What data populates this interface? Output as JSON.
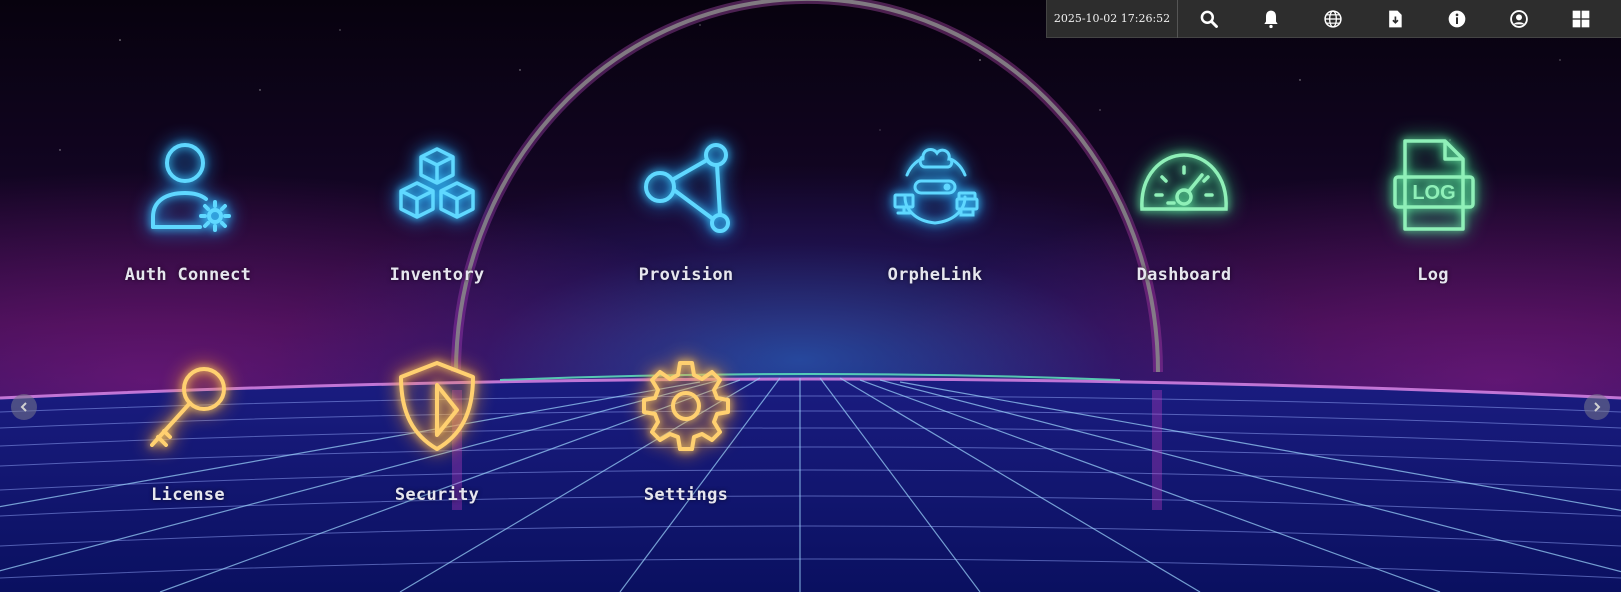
{
  "topbar": {
    "datetime": "2025-10-02 17:26:52",
    "buttons": [
      {
        "name": "search-button",
        "icon": "search-icon"
      },
      {
        "name": "notifications-button",
        "icon": "bell-icon"
      },
      {
        "name": "language-button",
        "icon": "globe-icon"
      },
      {
        "name": "download-button",
        "icon": "file-download-icon"
      },
      {
        "name": "info-button",
        "icon": "info-icon"
      },
      {
        "name": "account-button",
        "icon": "user-circle-icon"
      },
      {
        "name": "app-grid-button",
        "icon": "windows-grid-icon"
      }
    ]
  },
  "apps": [
    {
      "label": "Auth Connect",
      "icon": "user-gear-icon",
      "color": "#5fd8ff"
    },
    {
      "label": "Inventory",
      "icon": "cubes-icon",
      "color": "#5fd8ff"
    },
    {
      "label": "Provision",
      "icon": "network-nodes-icon",
      "color": "#5fd8ff"
    },
    {
      "label": "OrpheLink",
      "icon": "cloud-devices-icon",
      "color": "#5fd8ff"
    },
    {
      "label": "Dashboard",
      "icon": "speedometer-icon",
      "color": "#8ff0b8"
    },
    {
      "label": "Log",
      "icon": "log-file-icon",
      "color": "#8ff0b8"
    },
    {
      "label": "License",
      "icon": "key-icon",
      "color": "#ffd070"
    },
    {
      "label": "Security",
      "icon": "shield-icon",
      "color": "#ffd070"
    },
    {
      "label": "Settings",
      "icon": "gear-icon",
      "color": "#ffd070"
    }
  ],
  "log_icon_text": "LOG",
  "colors": {
    "topbar_bg": "#2d2d2d",
    "cyan": "#5fd8ff",
    "green": "#8ff0b8",
    "gold": "#ffd070"
  }
}
